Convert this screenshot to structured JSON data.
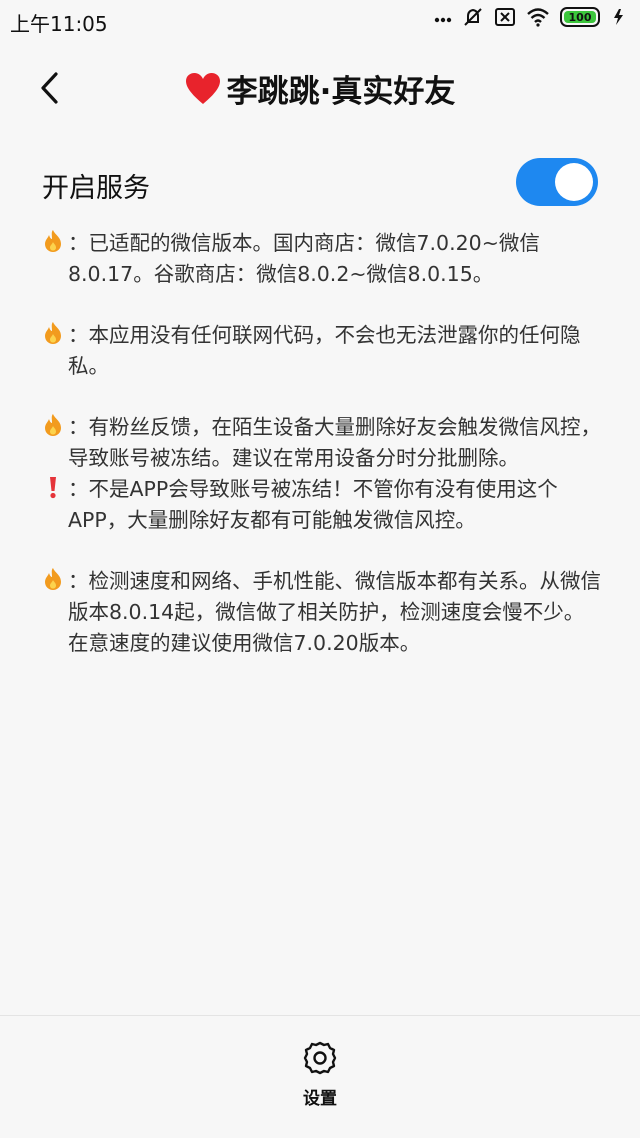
{
  "status_bar": {
    "time": "上午11:05",
    "battery_level": "100",
    "icons": [
      "dots-icon",
      "mute-icon",
      "sim-icon",
      "wifi-icon",
      "battery-icon",
      "charging-icon"
    ]
  },
  "header": {
    "title": "李跳跳·真实好友",
    "heart_icon": "heart-icon",
    "back_icon": "back-arrow-icon"
  },
  "service": {
    "label": "开启服务",
    "enabled": true,
    "accent": "#1e88f0"
  },
  "notes": [
    {
      "icon": "fire",
      "text": "：已适配的微信版本。国内商店：微信7.0.20~微信8.0.17。谷歌商店：微信8.0.2~微信8.0.15。"
    },
    {
      "icon": "fire",
      "text": "：本应用没有任何联网代码，不会也无法泄露你的任何隐私。"
    },
    {
      "icon": "fire",
      "text": "：有粉丝反馈，在陌生设备大量删除好友会触发微信风控，导致账号被冻结。建议在常用设备分时分批删除。"
    },
    {
      "icon": "exclamation",
      "text": "：不是APP会导致账号被冻结！不管你有没有使用这个APP，大量删除好友都有可能触发微信风控。"
    },
    {
      "icon": "fire",
      "text": "：检测速度和网络、手机性能、微信版本都有关系。从微信版本8.0.14起，微信做了相关防护，检测速度会慢不少。在意速度的建议使用微信7.0.20版本。"
    }
  ],
  "bottom_nav": {
    "settings_label": "设置",
    "settings_icon": "gear-icon"
  }
}
